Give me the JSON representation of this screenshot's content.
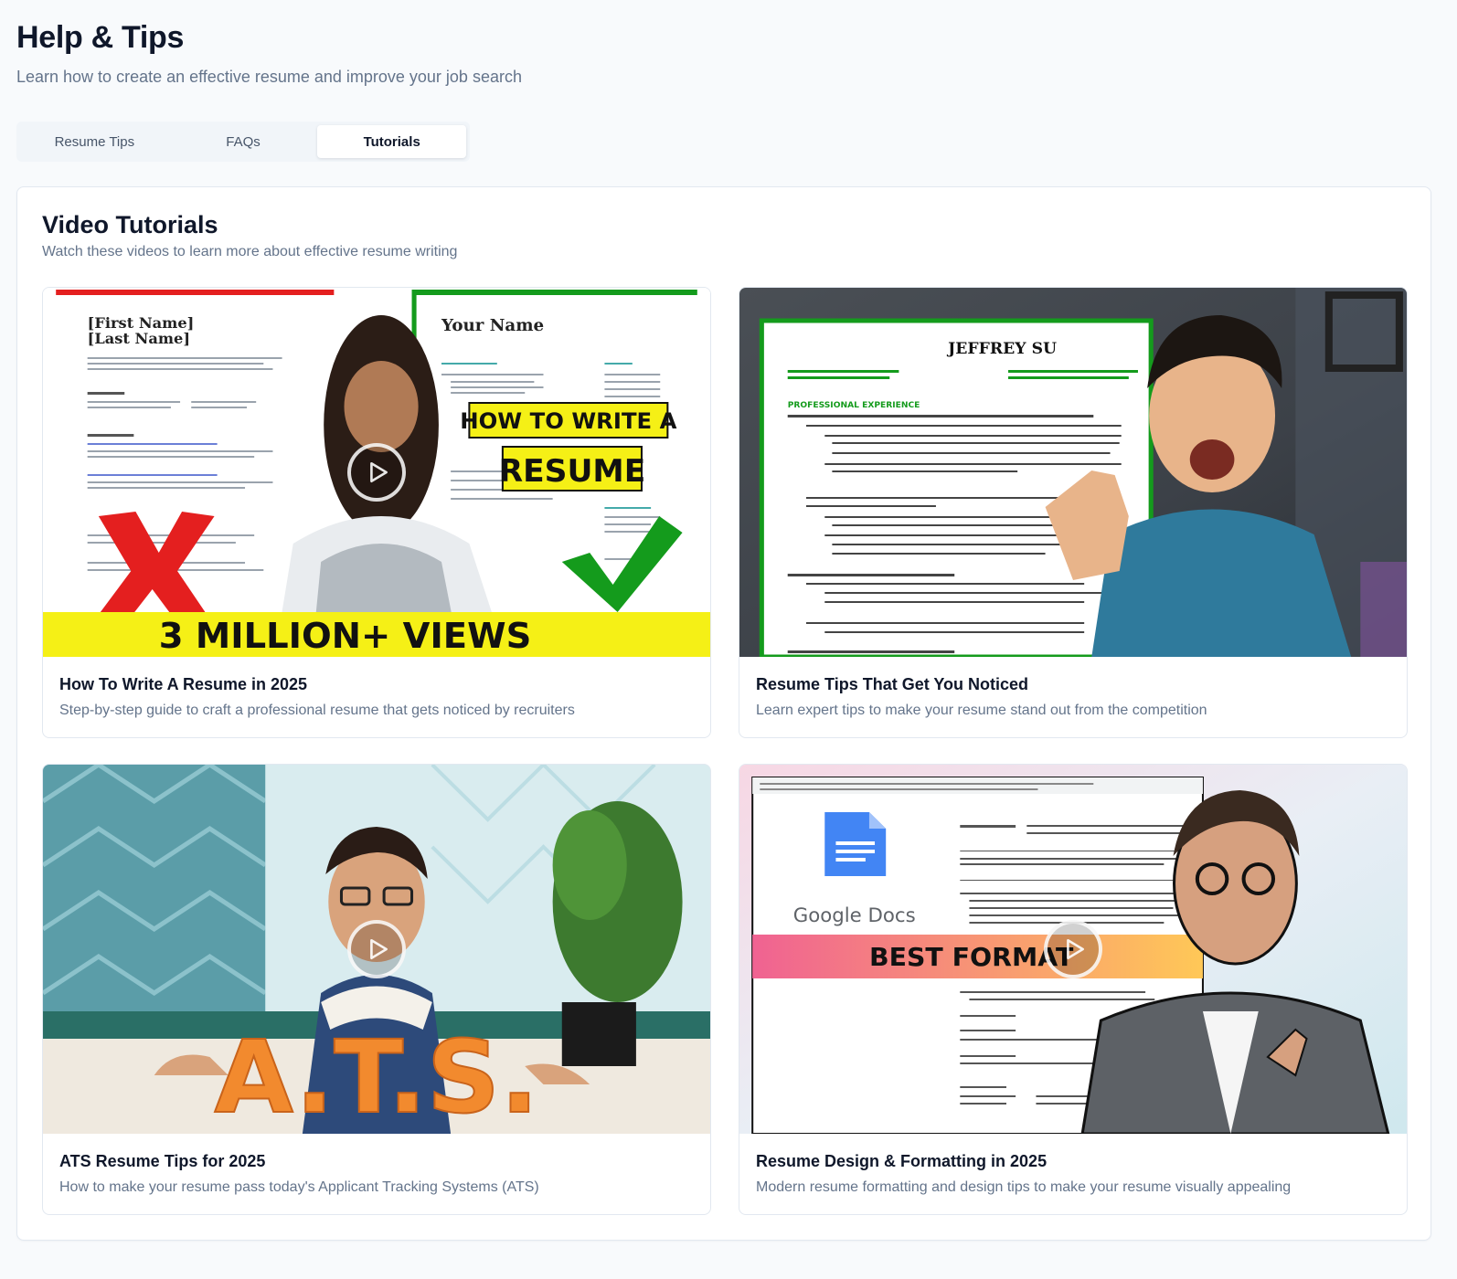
{
  "header": {
    "title": "Help & Tips",
    "subtitle": "Learn how to create an effective resume and improve your job search"
  },
  "tabs": [
    {
      "label": "Resume Tips",
      "active": false
    },
    {
      "label": "FAQs",
      "active": false
    },
    {
      "label": "Tutorials",
      "active": true
    }
  ],
  "section": {
    "title": "Video Tutorials",
    "subtitle": "Watch these videos to learn more about effective resume writing"
  },
  "videos": [
    {
      "title": "How To Write A Resume in 2025",
      "description": "Step-by-step guide to craft a professional resume that gets noticed by recruiters",
      "thumb_text": {
        "name_block": "[First Name]",
        "name_block2": "[Last Name]",
        "your_name": "Your Name",
        "banner1": "HOW TO WRITE A",
        "banner2": "RESUME",
        "footer": "3 MILLION+ VIEWS"
      }
    },
    {
      "title": "Resume Tips That Get You Noticed",
      "description": "Learn expert tips to make your resume stand out from the competition",
      "thumb_text": {
        "name": "JEFFREY SU",
        "section": "PROFESSIONAL EXPERIENCE"
      }
    },
    {
      "title": "ATS Resume Tips for 2025",
      "description": "How to make your resume pass today's Applicant Tracking Systems (ATS)",
      "thumb_text": {
        "big": "A.T.S."
      }
    },
    {
      "title": "Resume Design & Formatting in 2025",
      "description": "Modern resume formatting and design tips to make your resume visually appealing",
      "thumb_text": {
        "brand": "Google Docs",
        "banner": "BEST FORMAT"
      }
    }
  ],
  "colors": {
    "accent_yellow": "#f5f016",
    "check_green": "#149b1c",
    "cross_red": "#e41f1f",
    "ats_orange": "#f28a2e",
    "docs_blue": "#4285f4",
    "banner_pink": "#f06292"
  },
  "icons": {
    "play": "play-circle-icon"
  }
}
